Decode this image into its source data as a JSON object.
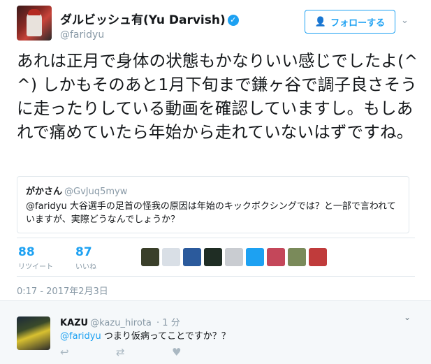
{
  "tweet": {
    "display_name": "ダルビッシュ有(Yu Darvish)",
    "verified_icon": "✓",
    "username": "@faridyu",
    "follow_label": "フォローする",
    "follow_icon": "person-add-icon",
    "caret": "⌄",
    "text": "あれは正月で身体の状態もかなりいい感じでしたよ(^^) しかもそのあと1月下旬まで鎌ヶ谷で調子良さそうに走ったりしている動画を確認していますし。もしあれで痛めていたら年始から走れていないはずですね。",
    "quote": {
      "name": "がかさん",
      "username": "@GvJuq5myw",
      "text": "@faridyu 大谷選手の足首の怪我の原因は年始のキックボクシングでは？と一部で言われていますが、実際どうなんでしょうか？"
    },
    "retweets": {
      "count": "88",
      "label": "リツイート"
    },
    "likes": {
      "count": "87",
      "label": "いいね"
    },
    "liker_avatars": [
      "#3a3f2a",
      "#d9dfe6",
      "#2b5a9c",
      "#1f2d24",
      "#c9ccd1",
      "#1da1f2",
      "#c4475a",
      "#7a8a5a",
      "#c03b3b"
    ],
    "timestamp": "0:17 - 2017年2月3日"
  },
  "reply": {
    "name": "KAZU",
    "username": "@kazu_hirota",
    "time": "· 1 分",
    "mention": "@faridyu",
    "text": " つまり仮病ってことですか？？",
    "caret": "⌄",
    "actions": {
      "reply": "↩",
      "retweet": "⇄",
      "like": "♥"
    }
  },
  "colors": {
    "accent": "#1da1f2",
    "muted": "#8899a6",
    "border": "#e1e8ed"
  }
}
